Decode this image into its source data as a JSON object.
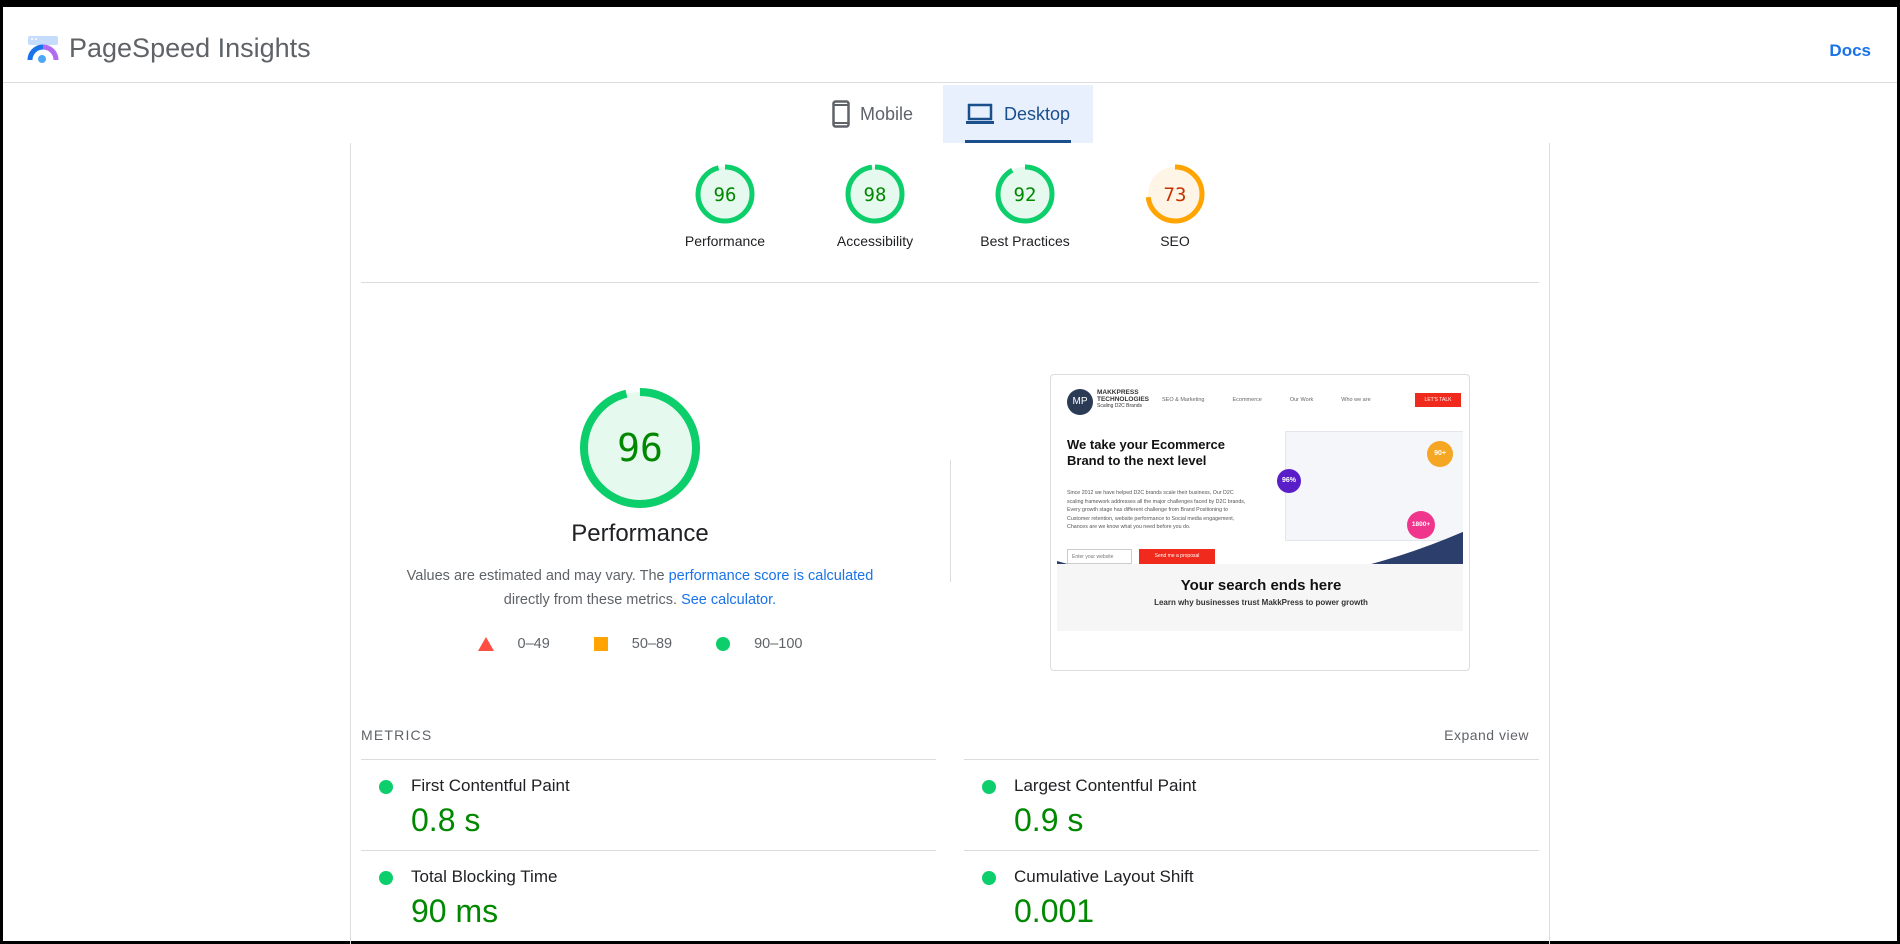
{
  "header": {
    "brand": "PageSpeed Insights",
    "docs": "Docs"
  },
  "tabs": [
    {
      "label": "Mobile",
      "icon": "phone-icon",
      "active": false
    },
    {
      "label": "Desktop",
      "icon": "laptop-icon",
      "active": true
    }
  ],
  "scores": [
    {
      "label": "Performance",
      "value": 96,
      "color": "#0cce6b",
      "text_color": "#008800",
      "bg": "#e6f9ee"
    },
    {
      "label": "Accessibility",
      "value": 98,
      "color": "#0cce6b",
      "text_color": "#008800",
      "bg": "#e6f9ee"
    },
    {
      "label": "Best Practices",
      "value": 92,
      "color": "#0cce6b",
      "text_color": "#008800",
      "bg": "#e6f9ee"
    },
    {
      "label": "SEO",
      "value": 73,
      "color": "#ffa400",
      "text_color": "#c33300",
      "bg": "#fff5e6"
    }
  ],
  "performance": {
    "score": "96",
    "title": "Performance",
    "desc_1": "Values are estimated and may vary. The ",
    "desc_link_1": "performance score is calculated",
    "desc_2": " directly from these metrics. ",
    "desc_link_2": "See calculator.",
    "legend": [
      {
        "icon": "triangle-icon",
        "label": "0–49",
        "color": "#ff4e42"
      },
      {
        "icon": "square-icon",
        "label": "50–89",
        "color": "#ffa400"
      },
      {
        "icon": "circle-icon",
        "label": "90–100",
        "color": "#0cce6b"
      }
    ]
  },
  "screenshot": {
    "logo_line1": "MAKKPRESS",
    "logo_line2": "TECHNOLOGIES",
    "logo_line3": "Scaling D2C Brands",
    "nav": [
      "SEO & Marketing",
      "Ecommerce",
      "Our Work",
      "Who we are"
    ],
    "cta": "LET'S TALK",
    "headline": "We take your Ecommerce Brand to the next level",
    "body": "Since 2012 we have helped D2C brands scale their business, Our D2C scaling framework addresses all the major challenges faced by D2C brands, Every growth stage has different challenge from Brand Positioning to Customer retention, website performance to Social media engagement, Chances are we know what you need before you do.",
    "input_placeholder": "Enter your website",
    "button": "Send me a proposal",
    "badge_1": "96%",
    "badge_2": "90+",
    "badge_3": "1800+",
    "section_title": "Your search ends here",
    "section_sub": "Learn why businesses trust MakkPress to power growth"
  },
  "metrics": {
    "heading": "METRICS",
    "expand": "Expand view",
    "items": [
      {
        "name": "First Contentful Paint",
        "value": "0.8 s",
        "status": "good"
      },
      {
        "name": "Largest Contentful Paint",
        "value": "0.9 s",
        "status": "good"
      },
      {
        "name": "Total Blocking Time",
        "value": "90 ms",
        "status": "good"
      },
      {
        "name": "Cumulative Layout Shift",
        "value": "0.001",
        "status": "good"
      }
    ]
  }
}
